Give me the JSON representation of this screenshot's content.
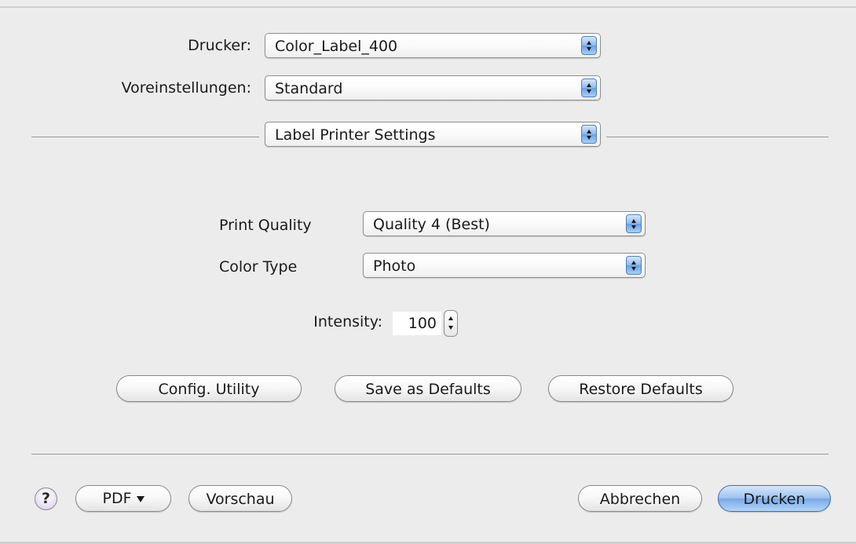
{
  "printer": {
    "label": "Drucker:",
    "value": "Color_Label_400"
  },
  "presets": {
    "label": "Voreinstellungen:",
    "value": "Standard"
  },
  "panel": {
    "value": "Label Printer Settings"
  },
  "print_quality": {
    "label": "Print Quality",
    "value": "Quality 4 (Best)"
  },
  "color_type": {
    "label": "Color Type",
    "value": "Photo"
  },
  "intensity": {
    "label": "Intensity:",
    "value": "100"
  },
  "buttons": {
    "config_utility": "Config. Utility",
    "save_defaults": "Save as Defaults",
    "restore_defaults": "Restore Defaults"
  },
  "footer": {
    "help": "?",
    "pdf": "PDF",
    "preview": "Vorschau",
    "cancel": "Abbrechen",
    "print": "Drucken"
  },
  "colors": {
    "background": "#ececec",
    "accent_blue": "#77a9e6",
    "help_tint": "#ebe2f1"
  },
  "icons": {
    "popup_arrows": "up-down-arrows-icon",
    "stepper": "stepper-arrows-icon",
    "pdf_menu": "triangle-down-icon",
    "help": "question-mark-icon"
  }
}
